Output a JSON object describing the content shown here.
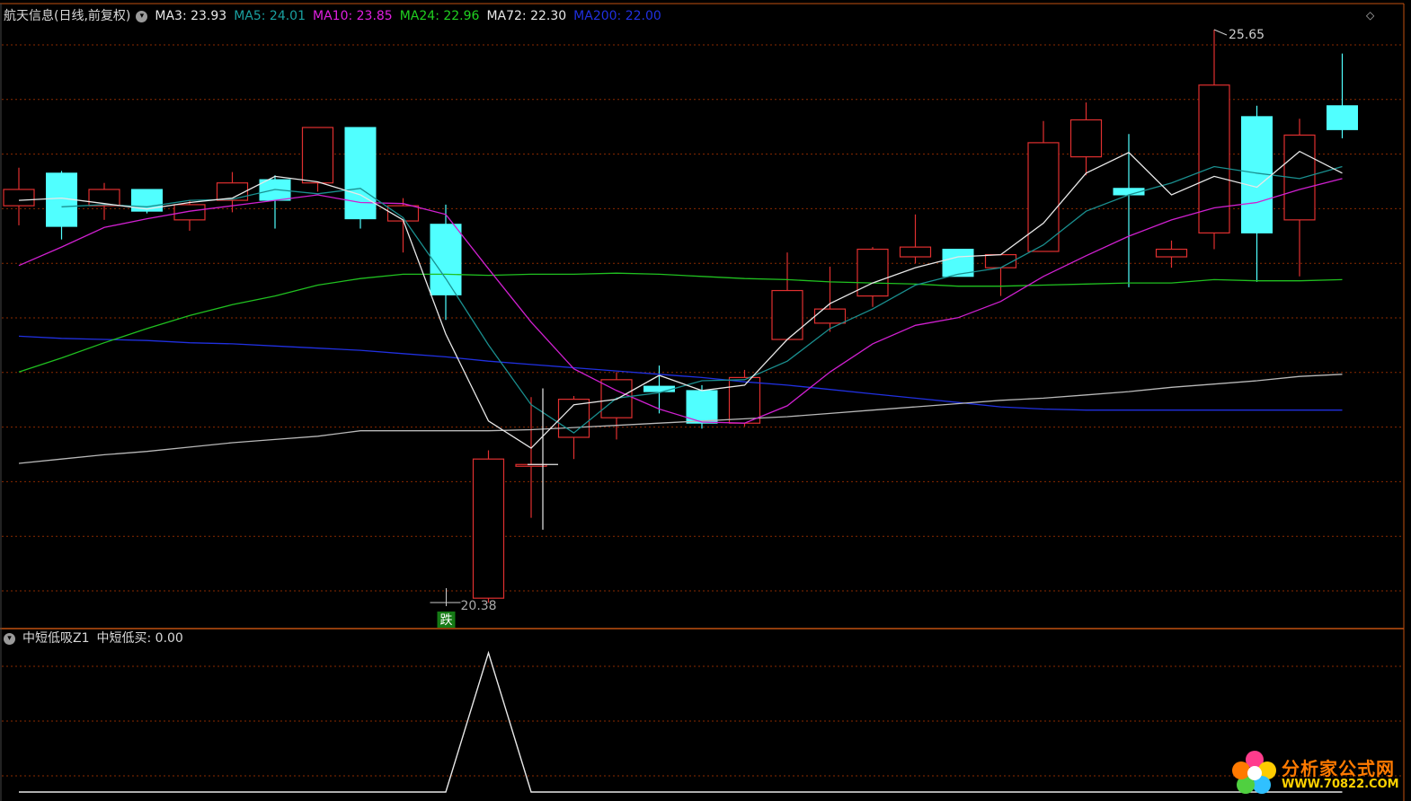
{
  "header": {
    "stock": "航天信息(日线,前复权)",
    "ma": [
      {
        "label": "MA3: 23.93",
        "color": "#e8e8e8"
      },
      {
        "label": "MA5: 24.01",
        "color": "#1aa0a0"
      },
      {
        "label": "MA10: 23.85",
        "color": "#e020e0"
      },
      {
        "label": "MA24: 22.96",
        "color": "#20d020"
      },
      {
        "label": "MA72: 22.30",
        "color": "#e8e8e8"
      },
      {
        "label": "MA200: 22.00",
        "color": "#2030e0"
      }
    ]
  },
  "annotations": {
    "high_label": "25.65",
    "low_label": "20.38",
    "signal_label": "跌"
  },
  "sub_panel": {
    "indicator": "中短低吸Z1",
    "value_label": "中短低买: 0.00"
  },
  "watermark": {
    "name": "分析家公式网",
    "url": "WWW.70822.COM"
  },
  "colors": {
    "up": "#e03030",
    "down": "#50ffff",
    "grid": "#8a2a00",
    "frame": "#c05010"
  },
  "chart_data": [
    {
      "type": "candlestick",
      "price_range": [
        20.38,
        25.65
      ],
      "candles": [
        {
          "o": 24.03,
          "h": 24.38,
          "l": 23.85,
          "c": 24.18
        },
        {
          "o": 24.33,
          "h": 24.35,
          "l": 23.72,
          "c": 23.84
        },
        {
          "o": 24.03,
          "h": 24.24,
          "l": 23.9,
          "c": 24.18
        },
        {
          "o": 24.18,
          "h": 24.18,
          "l": 23.96,
          "c": 23.98
        },
        {
          "o": 23.9,
          "h": 24.08,
          "l": 23.8,
          "c": 24.04
        },
        {
          "o": 24.08,
          "h": 24.34,
          "l": 23.97,
          "c": 24.24
        },
        {
          "o": 24.27,
          "h": 24.31,
          "l": 23.82,
          "c": 24.08
        },
        {
          "o": 24.24,
          "h": 24.75,
          "l": 24.16,
          "c": 24.75
        },
        {
          "o": 24.75,
          "h": 24.75,
          "l": 23.82,
          "c": 23.91
        },
        {
          "o": 23.89,
          "h": 24.1,
          "l": 23.6,
          "c": 24.03
        },
        {
          "o": 23.86,
          "h": 24.04,
          "l": 22.98,
          "c": 23.21
        },
        {
          "o": 20.42,
          "h": 21.78,
          "l": 20.38,
          "c": 21.7
        },
        {
          "o": 21.65,
          "h": 22.27,
          "l": 21.16,
          "c": 21.65
        },
        {
          "o": 21.9,
          "h": 22.28,
          "l": 21.7,
          "c": 22.25
        },
        {
          "o": 22.08,
          "h": 22.5,
          "l": 21.88,
          "c": 22.43
        },
        {
          "o": 22.37,
          "h": 22.56,
          "l": 22.12,
          "c": 22.32
        },
        {
          "o": 22.33,
          "h": 22.38,
          "l": 21.98,
          "c": 22.03
        },
        {
          "o": 22.03,
          "h": 22.52,
          "l": 22.0,
          "c": 22.45
        },
        {
          "o": 22.8,
          "h": 23.6,
          "l": 22.8,
          "c": 23.25
        },
        {
          "o": 22.95,
          "h": 23.47,
          "l": 22.87,
          "c": 23.08
        },
        {
          "o": 23.2,
          "h": 23.65,
          "l": 23.1,
          "c": 23.63
        },
        {
          "o": 23.56,
          "h": 23.95,
          "l": 23.5,
          "c": 23.65
        },
        {
          "o": 23.63,
          "h": 23.63,
          "l": 23.45,
          "c": 23.38
        },
        {
          "o": 23.46,
          "h": 23.58,
          "l": 23.2,
          "c": 23.58
        },
        {
          "o": 23.61,
          "h": 24.81,
          "l": 23.61,
          "c": 24.61
        },
        {
          "o": 24.48,
          "h": 24.98,
          "l": 24.31,
          "c": 24.82
        },
        {
          "o": 24.19,
          "h": 24.69,
          "l": 23.28,
          "c": 24.13
        },
        {
          "o": 23.56,
          "h": 23.71,
          "l": 23.46,
          "c": 23.63
        },
        {
          "o": 23.78,
          "h": 25.65,
          "l": 23.63,
          "c": 25.14
        },
        {
          "o": 24.85,
          "h": 24.95,
          "l": 23.33,
          "c": 23.78
        },
        {
          "o": 23.9,
          "h": 24.83,
          "l": 23.38,
          "c": 24.68
        },
        {
          "o": 24.95,
          "h": 25.43,
          "l": 24.65,
          "c": 24.73
        }
      ],
      "ma3": [
        24.08,
        24.1,
        24.05,
        24.0,
        24.06,
        24.1,
        24.3,
        24.25,
        24.13,
        23.9,
        22.85,
        22.05,
        21.8,
        22.2,
        22.25,
        22.47,
        22.33,
        22.38,
        22.8,
        23.13,
        23.32,
        23.46,
        23.56,
        23.58,
        23.87,
        24.33,
        24.52,
        24.13,
        24.3,
        24.2,
        24.53,
        24.33
      ],
      "ma5": [
        null,
        24.02,
        24.04,
        24.02,
        24.08,
        24.09,
        24.18,
        24.14,
        24.19,
        23.92,
        23.36,
        22.75,
        22.2,
        21.94,
        22.26,
        22.31,
        22.42,
        22.43,
        22.6,
        22.9,
        23.08,
        23.3,
        23.4,
        23.46,
        23.67,
        23.98,
        24.13,
        24.24,
        24.39,
        24.33,
        24.28,
        24.39
      ],
      "ma10": [
        23.48,
        23.65,
        23.83,
        23.91,
        23.98,
        24.03,
        24.08,
        24.13,
        24.06,
        24.05,
        23.95,
        23.45,
        22.96,
        22.53,
        22.33,
        22.16,
        22.04,
        22.03,
        22.19,
        22.5,
        22.76,
        22.93,
        23.0,
        23.15,
        23.38,
        23.57,
        23.75,
        23.9,
        24.01,
        24.06,
        24.18,
        24.28
      ],
      "ma24": [
        22.5,
        22.63,
        22.77,
        22.9,
        23.02,
        23.12,
        23.2,
        23.3,
        23.36,
        23.4,
        23.4,
        23.39,
        23.4,
        23.4,
        23.41,
        23.4,
        23.38,
        23.36,
        23.35,
        23.33,
        23.32,
        23.31,
        23.29,
        23.29,
        23.3,
        23.31,
        23.32,
        23.32,
        23.35,
        23.34,
        23.34,
        23.35
      ],
      "ma72": [
        21.66,
        21.7,
        21.74,
        21.77,
        21.81,
        21.85,
        21.88,
        21.91,
        21.96,
        21.96,
        21.96,
        21.96,
        21.97,
        21.99,
        22.01,
        22.03,
        22.05,
        22.07,
        22.09,
        22.12,
        22.15,
        22.18,
        22.21,
        22.24,
        22.26,
        22.29,
        22.32,
        22.36,
        22.39,
        22.42,
        22.46,
        22.48
      ],
      "ma200": [
        22.83,
        22.81,
        22.8,
        22.79,
        22.77,
        22.76,
        22.74,
        22.72,
        22.7,
        22.67,
        22.64,
        22.6,
        22.57,
        22.54,
        22.51,
        22.48,
        22.45,
        22.41,
        22.38,
        22.34,
        22.3,
        22.26,
        22.22,
        22.18,
        22.16,
        22.15,
        22.15,
        22.15,
        22.15,
        22.15,
        22.15,
        22.15
      ]
    },
    {
      "type": "line",
      "title": "中短低吸Z1",
      "values": [
        0,
        0,
        0,
        0,
        0,
        0,
        0,
        0,
        0,
        0,
        0,
        1,
        0,
        0,
        0,
        0,
        0,
        0,
        0,
        0,
        0,
        0,
        0,
        0,
        0,
        0,
        0,
        0,
        0,
        0,
        0,
        0
      ],
      "ylim": [
        0,
        1
      ]
    }
  ]
}
